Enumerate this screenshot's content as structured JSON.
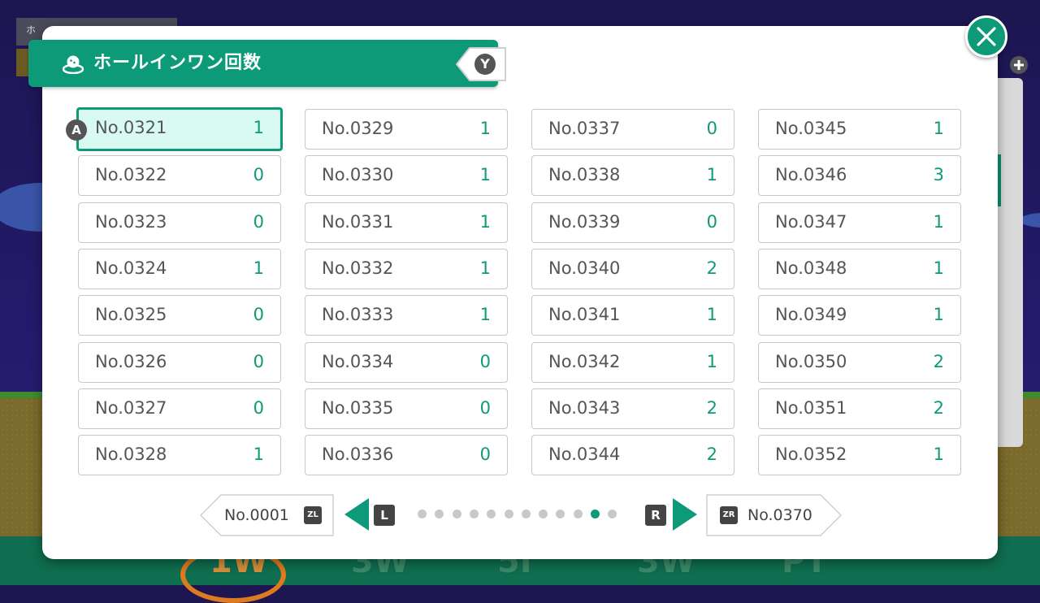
{
  "title": "ホールインワン回数",
  "buttons": {
    "y": "Y",
    "a": "A",
    "l": "L",
    "r": "R",
    "zl": "ZL",
    "zr": "ZR"
  },
  "pager": {
    "first": "No.0001",
    "last": "No.0370",
    "page_count": 12,
    "current_page": 11
  },
  "holes": [
    {
      "label": "No.0321",
      "value": "1",
      "selected": true
    },
    {
      "label": "No.0322",
      "value": "0"
    },
    {
      "label": "No.0323",
      "value": "0"
    },
    {
      "label": "No.0324",
      "value": "1"
    },
    {
      "label": "No.0325",
      "value": "0"
    },
    {
      "label": "No.0326",
      "value": "0"
    },
    {
      "label": "No.0327",
      "value": "0"
    },
    {
      "label": "No.0328",
      "value": "1"
    },
    {
      "label": "No.0329",
      "value": "1"
    },
    {
      "label": "No.0330",
      "value": "1"
    },
    {
      "label": "No.0331",
      "value": "1"
    },
    {
      "label": "No.0332",
      "value": "1"
    },
    {
      "label": "No.0333",
      "value": "1"
    },
    {
      "label": "No.0334",
      "value": "0"
    },
    {
      "label": "No.0335",
      "value": "0"
    },
    {
      "label": "No.0336",
      "value": "0"
    },
    {
      "label": "No.0337",
      "value": "0"
    },
    {
      "label": "No.0338",
      "value": "1"
    },
    {
      "label": "No.0339",
      "value": "0"
    },
    {
      "label": "No.0340",
      "value": "2"
    },
    {
      "label": "No.0341",
      "value": "1"
    },
    {
      "label": "No.0342",
      "value": "1"
    },
    {
      "label": "No.0343",
      "value": "2"
    },
    {
      "label": "No.0344",
      "value": "2"
    },
    {
      "label": "No.0345",
      "value": "1"
    },
    {
      "label": "No.0346",
      "value": "3"
    },
    {
      "label": "No.0347",
      "value": "1"
    },
    {
      "label": "No.0348",
      "value": "1"
    },
    {
      "label": "No.0349",
      "value": "1"
    },
    {
      "label": "No.0350",
      "value": "2"
    },
    {
      "label": "No.0351",
      "value": "2"
    },
    {
      "label": "No.0352",
      "value": "1"
    }
  ],
  "background": {
    "top_label": "ホ",
    "clubs": [
      "1W",
      "3W",
      "5I",
      "3W",
      "PT"
    ]
  },
  "colors": {
    "accent": "#0d9a78",
    "selected_bg": "#d8faf2",
    "cell_border": "#c8c8c8"
  },
  "icons": {
    "title": "golf-flag-hole-icon",
    "close": "close-icon",
    "prev": "arrow-left-icon",
    "next": "arrow-right-icon"
  }
}
